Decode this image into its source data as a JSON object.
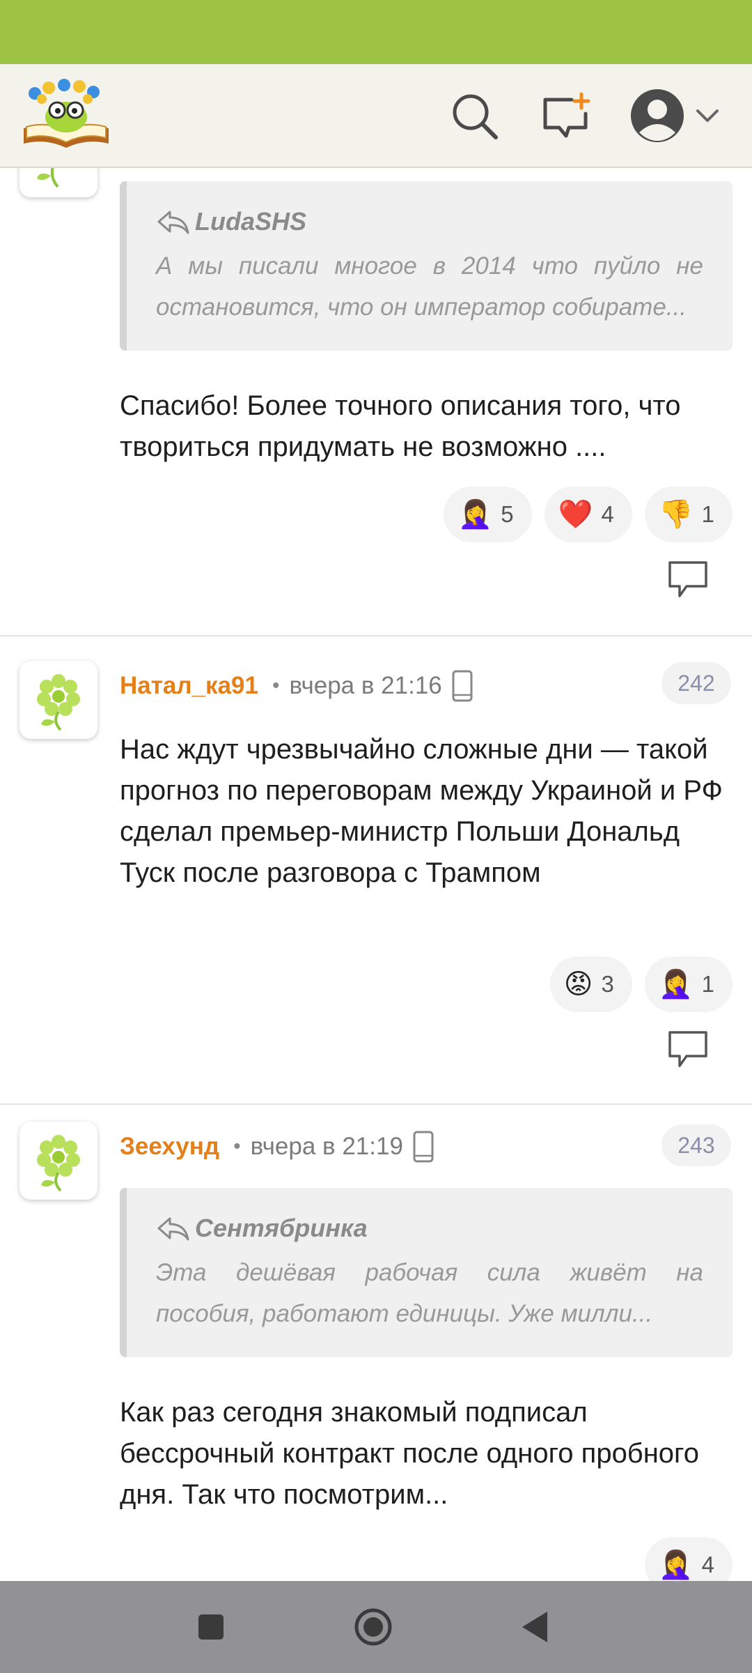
{
  "header": {
    "logo": "kid-reading-book-logo",
    "icons": [
      "search-icon",
      "new-post-icon",
      "profile-icon",
      "chevron-down-icon"
    ]
  },
  "comments": [
    {
      "quote": {
        "author": "LudaSHS",
        "line1": "А мы писали многое в 2014 что пуйло не",
        "line2": "остановится, что он император собирате..."
      },
      "text": "Спасибо! Более точного описания того, что твориться придумать не возможно ....",
      "reactions": [
        {
          "emoji": "🤦‍♀️",
          "count": "5"
        },
        {
          "emoji": "❤️",
          "count": "4"
        },
        {
          "emoji": "👎",
          "count": "1"
        }
      ]
    },
    {
      "author": "Натал_ка91",
      "time": "вчера в 21:16",
      "number": "242",
      "text": "Нас ждут чрезвычайно сложные дни — такой прогноз по переговорам между Украиной и РФ сделал премьер-министр Польши Дональд Туск после разговора с Трампом",
      "reactions": [
        {
          "emoji": "😡",
          "count": "3"
        },
        {
          "emoji": "🤦‍♀️",
          "count": "1"
        }
      ]
    },
    {
      "author": "Зеехунд",
      "time": "вчера в 21:19",
      "number": "243",
      "quote": {
        "author": "Сентябринка",
        "line1": "Эта дешёвая рабочая сила живёт на",
        "line2": "пособия, работают единицы. Уже милли..."
      },
      "text": "Как раз сегодня знакомый подписал бессрочный контракт после одного пробного дня. Так что посмотрим...",
      "reactions": [
        {
          "emoji": "🤦‍♀️",
          "count": "4"
        }
      ]
    }
  ],
  "navbar": {
    "icons": [
      "recent-apps-icon",
      "home-icon",
      "back-icon"
    ]
  }
}
